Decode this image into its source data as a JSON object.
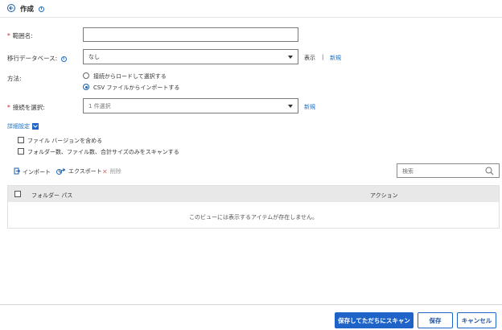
{
  "header": {
    "title": "作成"
  },
  "form": {
    "range_name_label": "範囲名:",
    "range_name_value": "",
    "migration_db_label": "移行データベース:",
    "migration_db_value": "なし",
    "show_link": "表示",
    "separator": "|",
    "new_link": "新規",
    "method_label": "方法:",
    "method_option_1": "接続からロードして選択する",
    "method_option_2": "CSV ファイルからインポートする",
    "connection_label": "接続を選択:",
    "connection_value": "1 件選択",
    "connection_new_link": "新規",
    "advanced_label": "詳細設定",
    "include_versions": "ファイル バージョンを含める",
    "scan_only": "フォルダー数、ファイル数、合計サイズのみをスキャンする"
  },
  "toolbar": {
    "import": "インポート",
    "export": "エクスポート",
    "delete": "削除",
    "search_placeholder": "検索"
  },
  "table": {
    "col_path": "フォルダー パス",
    "col_action": "アクション",
    "empty_message": "このビューには表示するアイテムが存在しません。"
  },
  "footer": {
    "save_scan": "保存してただちにスキャン",
    "save": "保存",
    "cancel": "キャンセル"
  },
  "colors": {
    "accent": "#1e64c8",
    "required": "#c4262e",
    "link": "#1f6fc4"
  }
}
